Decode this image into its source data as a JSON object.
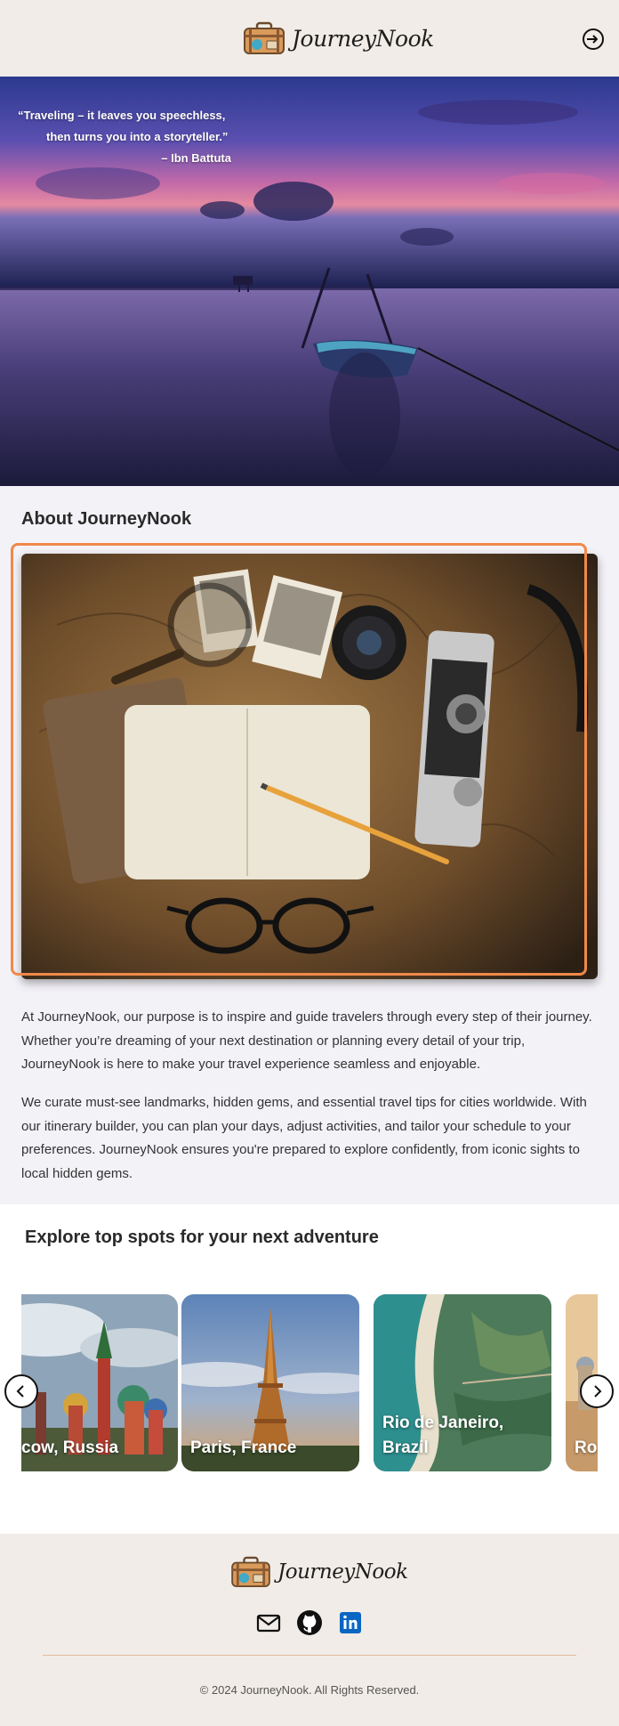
{
  "header": {
    "logo_text": "JourneyNook",
    "logo_icon": "suitcase-icon",
    "login_icon": "sign-in-icon"
  },
  "hero": {
    "quote_line1": "“Traveling – it leaves you speechless,",
    "quote_line2": "then turns you into a storyteller.”",
    "quote_author": "– Ibn Battuta"
  },
  "about": {
    "title": "About JourneyNook",
    "paragraph1": "At JourneyNook, our purpose is to inspire and guide travelers through every step of their journey. Whether you’re dreaming of your next destination or planning every detail of your trip, JourneyNook is here to make your travel experience seamless and enjoyable.",
    "paragraph2": "We curate must-see landmarks, hidden gems, and essential travel tips for cities worldwide. With our itinerary builder, you can plan your days, adjust activities, and tailor your schedule to your preferences. JourneyNook ensures you're prepared to explore confidently, from iconic sights to local hidden gems.",
    "highlight_color": "#f0894a"
  },
  "explore": {
    "title": "Explore top spots for your next adventure",
    "cards": [
      {
        "label": "Moscow, Russia",
        "visible_label": "oscow, Russia"
      },
      {
        "label": "Paris, France"
      },
      {
        "label": "Rio de Janeiro, Brazil"
      },
      {
        "label": "Ro"
      }
    ],
    "prev_icon": "chevron-left-icon",
    "next_icon": "chevron-right-icon"
  },
  "footer": {
    "logo_text": "JourneyNook",
    "social": [
      "mail-icon",
      "github-icon",
      "linkedin-icon"
    ],
    "copyright": "© 2024 JourneyNook. All Rights Reserved.",
    "linkedin_color": "#0a66c2"
  }
}
